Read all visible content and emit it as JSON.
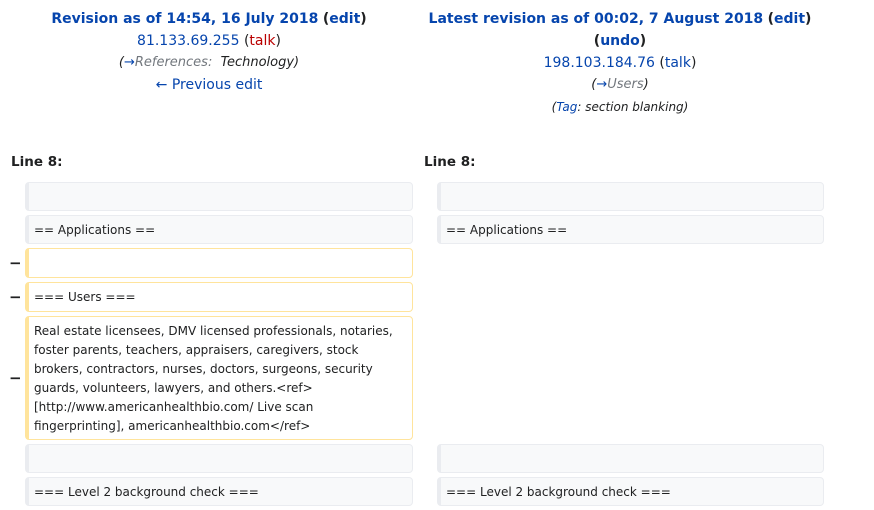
{
  "left_header": {
    "title": "Revision as of 14:54, 16 July 2018",
    "edit_label": "edit",
    "user": "81.133.69.255",
    "talk_label": "talk",
    "comment_arrow": "→",
    "comment_section": "References:",
    "comment_text": "Technology",
    "prev_edit_label": "← Previous edit"
  },
  "right_header": {
    "title": "Latest revision as of 00:02, 7 August 2018",
    "edit_label": "edit",
    "undo_label": "undo",
    "user": "198.103.184.76",
    "talk_label": "talk",
    "comment_arrow": "→",
    "comment_section": "Users",
    "tag_label": "Tag",
    "tag_value": "section blanking"
  },
  "line_left": "Line 8:",
  "line_right": "Line 8:",
  "marker": "−",
  "rows": {
    "ctx1": {
      "left": "",
      "right": ""
    },
    "ctx2": {
      "left": "== Applications ==",
      "right": "== Applications =="
    },
    "del1": "",
    "del2": "=== Users ===",
    "del3": "Real estate licensees, DMV licensed professionals, notaries, foster parents, teachers, appraisers, caregivers, stock brokers, contractors, nurses, doctors, surgeons, security guards, volunteers, lawyers, and others.<ref>[http://www.americanhealthbio.com/ Live scan fingerprinting], americanhealthbio.com</ref>",
    "ctx3": {
      "left": "",
      "right": ""
    },
    "ctx4": {
      "left": "=== Level 2 background check ===",
      "right": "=== Level 2 background check ==="
    }
  }
}
